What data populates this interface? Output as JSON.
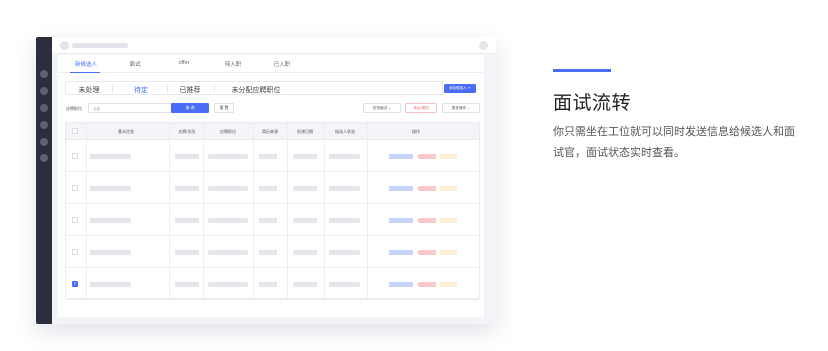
{
  "feature": {
    "title": "面试流转",
    "description": "你只需坐在工位就可以同时发送信息给候选人和面试官，面试状态实时查看。"
  },
  "colors": {
    "accent": "#4a6cf7",
    "rail": "#2b2f3d",
    "pill_blue": "#c9d3fb",
    "pill_red": "#f8c9cb",
    "pill_yellow": "#fbeed2"
  },
  "mock": {
    "tabs": [
      {
        "label": "新候选人",
        "active": true
      },
      {
        "label": "面试",
        "active": false
      },
      {
        "label": "offer",
        "active": false
      },
      {
        "label": "待入职",
        "active": false
      },
      {
        "label": "已入职",
        "active": false
      }
    ],
    "subtabs": [
      {
        "label": "未处理",
        "active": false
      },
      {
        "label": "待定",
        "active": true
      },
      {
        "label": "已推荐",
        "active": false
      },
      {
        "label": "未分配应聘职位",
        "active": false
      }
    ],
    "add_button": "添加候选人 ＋",
    "filter": {
      "label": "应聘职位",
      "placeholder": "全部",
      "query_button": "查 询",
      "reset_button": "重 置"
    },
    "actions": {
      "arrange_interview": "安排面试 ⌄",
      "eliminate": "淘汰/退回",
      "more": "更多操作 ⌄"
    },
    "table": {
      "columns": [
        "基本信息",
        "应聘/学历",
        "应聘职位",
        "简历来源",
        "投递日期",
        "候选人状态",
        "操作"
      ],
      "rows": [
        {
          "checked": false
        },
        {
          "checked": false
        },
        {
          "checked": false
        },
        {
          "checked": false
        },
        {
          "checked": true
        }
      ]
    },
    "icons": {
      "rail": "sidebar-nav-icon",
      "check": "checkmark-icon",
      "chevron": "chevron-down-icon"
    }
  }
}
